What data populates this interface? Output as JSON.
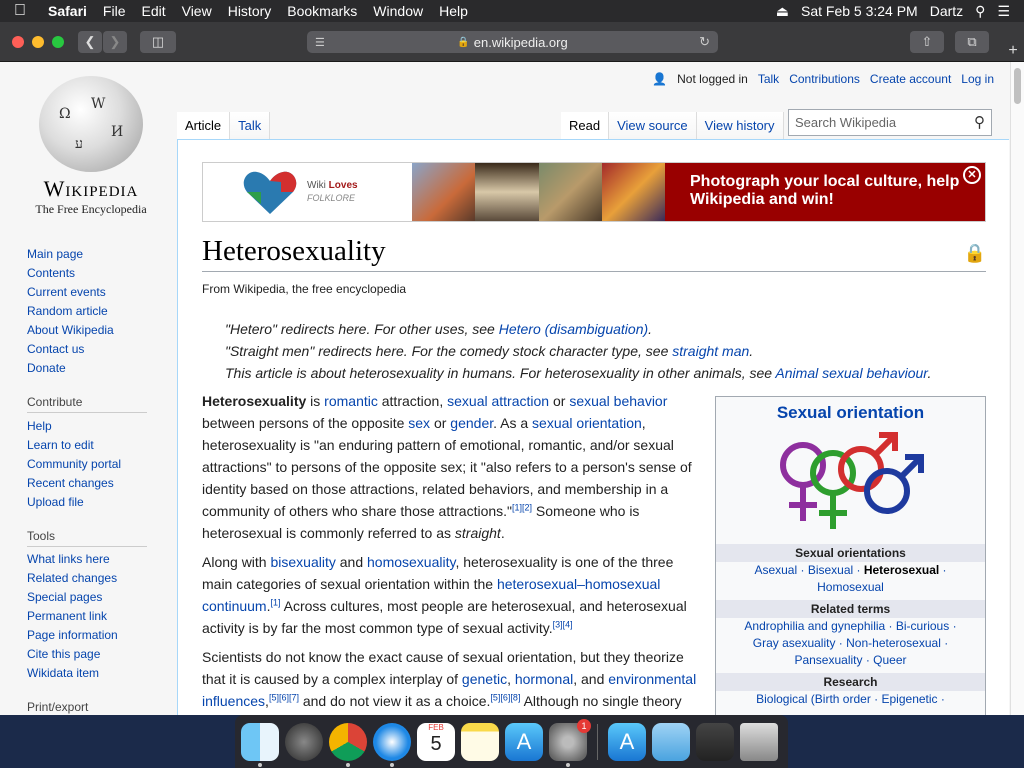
{
  "menubar": {
    "app_name": "Safari",
    "menus": [
      "File",
      "Edit",
      "View",
      "History",
      "Bookmarks",
      "Window",
      "Help"
    ],
    "datetime": "Sat Feb 5  3:24 PM",
    "user": "Dartz"
  },
  "browser": {
    "url": "en.wikipedia.org"
  },
  "wiki": {
    "wordmark": "Wikipedia",
    "tagline": "The Free Encyclopedia",
    "header_links": {
      "not_logged_in": "Not logged in",
      "talk": "Talk",
      "contributions": "Contributions",
      "create_account": "Create account",
      "login": "Log in"
    },
    "tabs_left": [
      "Article",
      "Talk"
    ],
    "tabs_right": [
      "Read",
      "View source",
      "View history"
    ],
    "search_placeholder": "Search Wikipedia",
    "nav_main": [
      "Main page",
      "Contents",
      "Current events",
      "Random article",
      "About Wikipedia",
      "Contact us",
      "Donate"
    ],
    "contribute_heading": "Contribute",
    "nav_contribute": [
      "Help",
      "Learn to edit",
      "Community portal",
      "Recent changes",
      "Upload file"
    ],
    "tools_heading": "Tools",
    "nav_tools": [
      "What links here",
      "Related changes",
      "Special pages",
      "Permanent link",
      "Page information",
      "Cite this page",
      "Wikidata item"
    ],
    "print_heading": "Print/export"
  },
  "banner": {
    "logo_line1": "Wiki",
    "logo_line1b": "Loves",
    "logo_line2": "FOLKLORE",
    "ad_text": "Photograph your local culture, help Wikipedia and win!"
  },
  "article": {
    "title": "Heterosexuality",
    "from": "From Wikipedia, the free encyclopedia",
    "hatnote1_a": "\"Hetero\" redirects here. For other uses, see ",
    "hatnote1_link": "Hetero (disambiguation)",
    "hatnote1_b": ".",
    "hatnote2_a": "\"Straight men\" redirects here. For the comedy stock character type, see ",
    "hatnote2_link": "straight man",
    "hatnote2_b": ".",
    "hatnote3_a": "This article is about heterosexuality in humans. For heterosexuality in other animals, see ",
    "hatnote3_link": "Animal sexual behaviour",
    "hatnote3_b": "."
  },
  "infobox": {
    "title": "Sexual orientation",
    "h1": "Sexual orientations",
    "r1a": "Asexual",
    "r1b": "Bisexual",
    "r1c": "Heterosexual",
    "r1d": "Homosexual",
    "h2": "Related terms",
    "r2a": "Androphilia and gynephilia",
    "r2b": "Bi-curious",
    "r2c": "Gray asexuality",
    "r2d": "Non-heterosexual",
    "r2e": "Pansexuality",
    "r2f": "Queer",
    "h3": "Research",
    "r3a": "Biological (Birth order",
    "r3b": "Epigenetic"
  },
  "dock": {
    "calendar_month": "FEB",
    "calendar_day": "5",
    "settings_badge": "1"
  }
}
